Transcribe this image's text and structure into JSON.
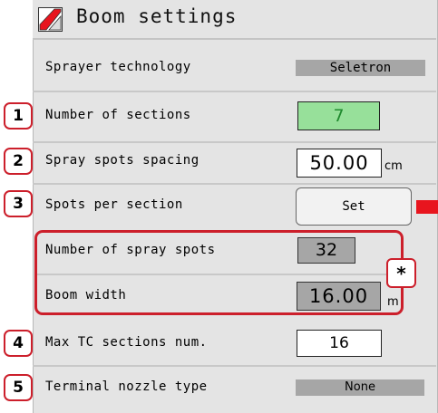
{
  "header": {
    "title": "Boom settings",
    "logo_icon": "red-slash-logo-icon"
  },
  "rows": {
    "sprayer_technology": {
      "label": "Sprayer technology",
      "value": "Seletron"
    },
    "number_of_sections": {
      "marker": "1",
      "label": "Number of sections",
      "value": "7"
    },
    "spray_spots_spacing": {
      "marker": "2",
      "label": "Spray spots spacing",
      "value": "50.00",
      "unit": "cm"
    },
    "spots_per_section": {
      "marker": "3",
      "label": "Spots per section",
      "button": "Set"
    },
    "number_of_spray_spots": {
      "label": "Number of spray spots",
      "value": "32"
    },
    "boom_width": {
      "label": "Boom width",
      "value": "16.00",
      "unit": "m"
    },
    "group_marker": "*",
    "max_tc_sections": {
      "marker": "4",
      "label": "Max TC sections num.",
      "value": "16"
    },
    "terminal_nozzle_type": {
      "marker": "5",
      "label": "Terminal nozzle type",
      "value": "None"
    }
  },
  "colors": {
    "accent_red": "#cc1f2b",
    "indicator_red": "#e8151e",
    "active_green": "#97e09a",
    "value_green": "#1f8a2e",
    "readonly_grey": "#a6a6a6"
  }
}
